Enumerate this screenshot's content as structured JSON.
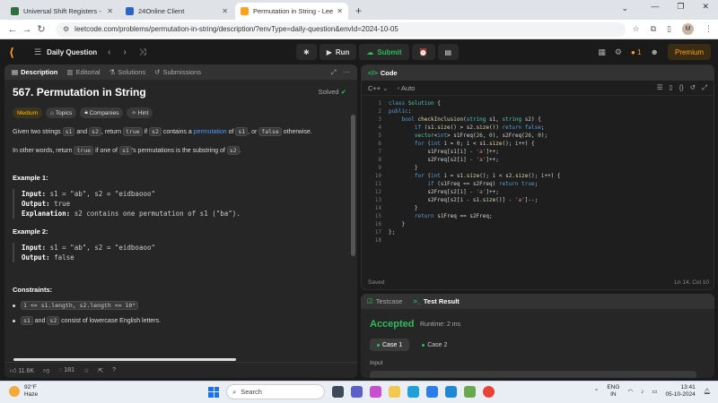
{
  "browser": {
    "tabs": [
      {
        "title": "Universal Shift Registers - Digit",
        "color": "#2b6f3a"
      },
      {
        "title": "24Online Client",
        "color": "#2a66c9"
      },
      {
        "title": "Permutation in String - LeetCo",
        "color": "#ffa116"
      }
    ],
    "url": "leetcode.com/problems/permutation-in-string/description/?envType=daily-question&envId=2024-10-05",
    "avatar_letter": "M"
  },
  "header": {
    "daily_label": "Daily Question",
    "run_label": "Run",
    "submit_label": "Submit",
    "streak": "1",
    "premium_label": "Premium"
  },
  "left": {
    "tabs": {
      "description": "Description",
      "editorial": "Editorial",
      "solutions": "Solutions",
      "submissions": "Submissions"
    },
    "title": "567. Permutation in String",
    "solved": "Solved",
    "tags": {
      "medium": "Medium",
      "topics": "Topics",
      "companies": "Companies",
      "hint": "Hint"
    },
    "p1": {
      "a": "Given two strings ",
      "s1": "s1",
      "and": " and ",
      "s2": "s2",
      "ret": ", return ",
      "true": "true",
      "if": " if ",
      "s2b": "s2",
      "cont": " contains a ",
      "perm": "permutation",
      "of": " of ",
      "s1b": "s1",
      "or": ", or ",
      "false": "false",
      "other": " otherwise."
    },
    "p2": {
      "a": "In other words, return ",
      "true": "true",
      "b": " if one of ",
      "s1": "s1",
      "c": "'s permutations is the substring of ",
      "s2": "s2",
      "d": "."
    },
    "ex1": {
      "head": "Example 1:",
      "in_lbl": "Input:",
      "in_val": " s1 = \"ab\", s2 = \"eidbaooo\"",
      "out_lbl": "Output:",
      "out_val": " true",
      "exp_lbl": "Explanation:",
      "exp_val": " s2 contains one permutation of s1 (\"ba\")."
    },
    "ex2": {
      "head": "Example 2:",
      "in_lbl": "Input:",
      "in_val": " s1 = \"ab\", s2 = \"eidboaoo\"",
      "out_lbl": "Output:",
      "out_val": " false"
    },
    "constraints": {
      "head": "Constraints:",
      "c1": "1 <= s1.length, s2.length <= 10⁴",
      "c2a": "s1",
      "c2b": " and ",
      "c2c": "s2",
      "c2d": " consist of lowercase English letters."
    },
    "footer": {
      "likes": "11.6K",
      "comments": "181"
    }
  },
  "code": {
    "title": "Code",
    "language": "C++",
    "mode": "Auto",
    "status": "Saved",
    "cursor": "Ln 14, Col 10"
  },
  "test": {
    "testcase_tab": "Testcase",
    "result_tab": "Test Result",
    "verdict": "Accepted",
    "runtime": "Runtime: 2 ms",
    "case1": "Case 1",
    "case2": "Case 2",
    "input_label": "Input"
  },
  "taskbar": {
    "temp": "92°F",
    "weather": "Haze",
    "search": "Search",
    "lang1": "ENG",
    "lang2": "IN",
    "time": "13:41",
    "date": "05-10-2024"
  }
}
